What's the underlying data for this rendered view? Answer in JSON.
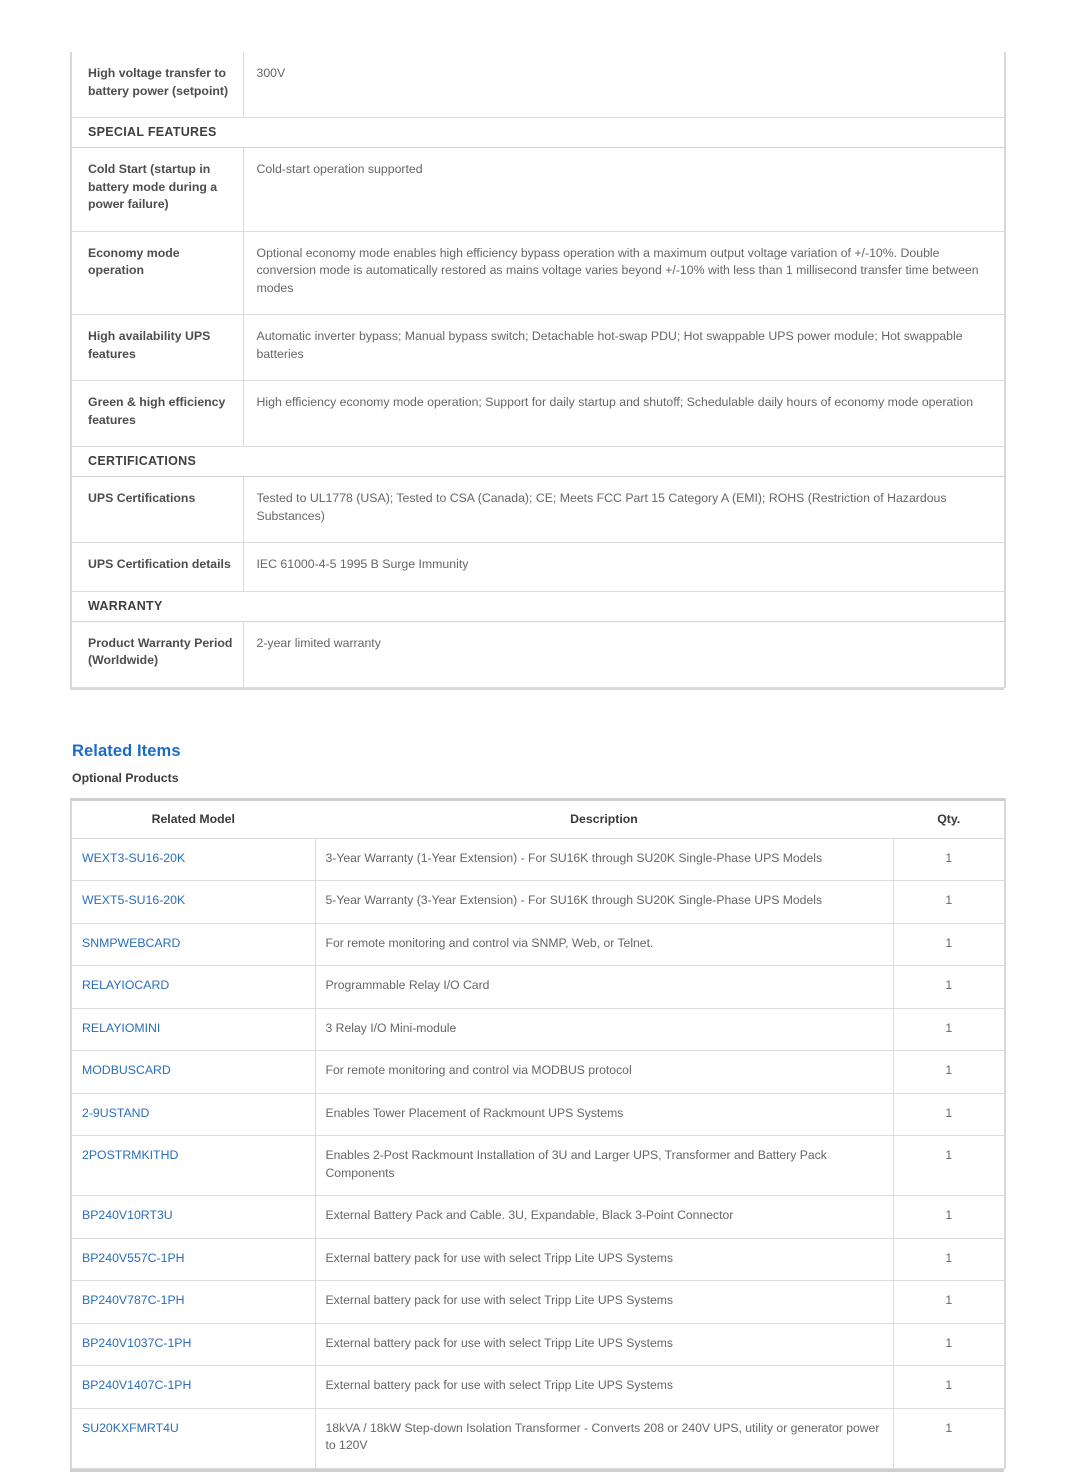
{
  "spec_table": {
    "rows": [
      {
        "kind": "row",
        "label": "High voltage transfer to battery power (setpoint)",
        "value": "300V"
      },
      {
        "kind": "section",
        "label": "SPECIAL FEATURES"
      },
      {
        "kind": "row",
        "label": "Cold Start (startup in battery mode during a power failure)",
        "value": "Cold-start operation supported"
      },
      {
        "kind": "row",
        "label": "Economy mode operation",
        "value": "Optional economy mode enables high efficiency bypass operation with a maximum output voltage variation of +/-10%. Double conversion mode is automatically restored as mains voltage varies beyond +/-10% with less than 1 millisecond transfer time between modes"
      },
      {
        "kind": "row",
        "label": "High availability UPS features",
        "value": "Automatic inverter bypass; Manual bypass switch; Detachable hot-swap PDU; Hot swappable UPS power module; Hot swappable batteries"
      },
      {
        "kind": "row",
        "label": "Green & high efficiency features",
        "value": "High efficiency economy mode operation; Support for daily startup and shutoff; Schedulable daily hours of economy mode operation"
      },
      {
        "kind": "section",
        "label": "CERTIFICATIONS"
      },
      {
        "kind": "row",
        "label": "UPS Certifications",
        "value": "Tested to UL1778 (USA); Tested to CSA (Canada); CE; Meets FCC Part 15 Category A (EMI); ROHS (Restriction of Hazardous Substances)"
      },
      {
        "kind": "row",
        "label": "UPS Certification details",
        "value": "IEC 61000-4-5 1995 B Surge Immunity"
      },
      {
        "kind": "section",
        "label": "WARRANTY"
      },
      {
        "kind": "row",
        "label": "Product Warranty Period (Worldwide)",
        "value": "2-year limited warranty"
      }
    ]
  },
  "related": {
    "title": "Related Items",
    "subtitle": "Optional Products",
    "columns": [
      "Related Model",
      "Description",
      "Qty."
    ],
    "rows": [
      {
        "model": "WEXT3-SU16-20K",
        "description": "3-Year Warranty (1-Year Extension) - For SU16K through SU20K Single-Phase UPS Models",
        "qty": "1"
      },
      {
        "model": "WEXT5-SU16-20K",
        "description": "5-Year Warranty (3-Year Extension) - For SU16K through SU20K Single-Phase UPS Models",
        "qty": "1"
      },
      {
        "model": "SNMPWEBCARD",
        "description": "For remote monitoring and control via SNMP, Web, or Telnet.",
        "qty": "1"
      },
      {
        "model": "RELAYIOCARD",
        "description": "Programmable Relay I/O Card",
        "qty": "1"
      },
      {
        "model": "RELAYIOMINI",
        "description": "3 Relay I/O Mini-module",
        "qty": "1"
      },
      {
        "model": "MODBUSCARD",
        "description": "For remote monitoring and control via MODBUS protocol",
        "qty": "1"
      },
      {
        "model": "2-9USTAND",
        "description": "Enables Tower Placement of Rackmount UPS Systems",
        "qty": "1"
      },
      {
        "model": "2POSTRMKITHD",
        "description": "Enables 2-Post Rackmount Installation of 3U and Larger UPS, Transformer and Battery Pack Components",
        "qty": "1"
      },
      {
        "model": "BP240V10RT3U",
        "description": "External Battery Pack and Cable. 3U, Expandable, Black 3-Point Connector",
        "qty": "1"
      },
      {
        "model": "BP240V557C-1PH",
        "description": "External battery pack for use with select Tripp Lite UPS Systems",
        "qty": "1"
      },
      {
        "model": "BP240V787C-1PH",
        "description": "External battery pack for use with select Tripp Lite UPS Systems",
        "qty": "1"
      },
      {
        "model": "BP240V1037C-1PH",
        "description": "External battery pack for use with select Tripp Lite UPS Systems",
        "qty": "1"
      },
      {
        "model": "BP240V1407C-1PH",
        "description": "External battery pack for use with select Tripp Lite UPS Systems",
        "qty": "1"
      },
      {
        "model": "SU20KXFMRT4U",
        "description": "18kVA / 18kW Step-down Isolation Transformer - Converts 208 or 240V UPS, utility or generator power to 120V",
        "qty": "1"
      }
    ]
  },
  "colors": {
    "heading_blue": "#1c6cc4",
    "link_blue": "#2a6ebb",
    "body_text": "#666666",
    "label_text": "#4d4d4d",
    "border": "#dcdcdc"
  }
}
